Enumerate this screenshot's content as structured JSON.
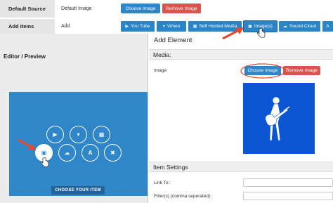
{
  "default_source": {
    "label": "Default Source",
    "value": "Default Image",
    "choose_label": "Choose Image",
    "remove_label": "Remove Image"
  },
  "add_items": {
    "label": "Add Items",
    "value": "Add",
    "buttons": [
      {
        "label": "You Tube",
        "icon": "youtube-icon"
      },
      {
        "label": "Vimeo",
        "icon": "vimeo-icon"
      },
      {
        "label": "Self Hosted Media",
        "icon": "film-icon"
      },
      {
        "label": "Image(s)",
        "icon": "image-icon"
      },
      {
        "label": "Sound Cloud",
        "icon": "soundcloud-icon"
      },
      {
        "label": "A",
        "icon": "text-icon"
      }
    ]
  },
  "editor": {
    "title": "Editor / Preview",
    "choose_item_label": "CHOOSE YOUR ITEM",
    "circle_icons": [
      "youtube-icon",
      "vimeo-icon",
      "film-icon",
      "image-icon",
      "soundcloud-icon",
      "text-icon",
      "close-icon"
    ]
  },
  "add_element": {
    "title": "Add Element",
    "media_section": "Media:",
    "image_label": "Image",
    "choose_label": "Choose Image",
    "remove_label": "Remove Image",
    "item_settings_section": "Item Settings",
    "link_to_label": "Link To::",
    "filters_label": "Filter(s) (comma seperated):"
  },
  "colors": {
    "primary": "#2f86c9",
    "danger": "#d9534f",
    "image_bg": "#0a55d3",
    "annotation": "#e8472c"
  }
}
